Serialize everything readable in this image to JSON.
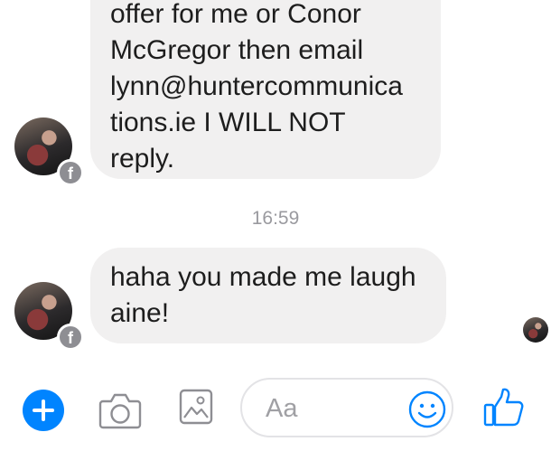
{
  "messages": [
    {
      "lines": [
        "offer for me or Conor",
        "McGregor then email",
        "lynn@huntercommunica",
        "tions.ie I WILL NOT",
        "reply."
      ]
    },
    {
      "lines": [
        "haha you made me laugh",
        "aine!"
      ]
    }
  ],
  "timestamp": "16:59",
  "composer": {
    "placeholder": "Aa"
  },
  "icons": {
    "add": "plus-icon",
    "camera": "camera-icon",
    "photo": "photo-icon",
    "emoji": "emoji-icon",
    "like": "thumbs-up-icon",
    "badge": "facebook-icon"
  },
  "colors": {
    "accent": "#0084ff",
    "bubble": "#f1f0f0",
    "timestamp": "#9a9a9f",
    "icon_gray": "#8e8e93"
  }
}
